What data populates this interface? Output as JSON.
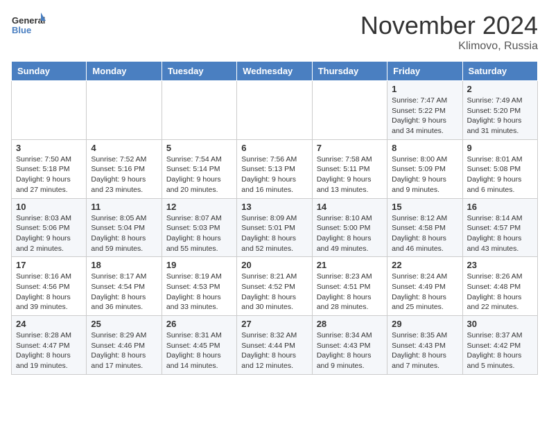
{
  "header": {
    "logo_line1": "General",
    "logo_line2": "Blue",
    "month": "November 2024",
    "location": "Klimovo, Russia"
  },
  "days_of_week": [
    "Sunday",
    "Monday",
    "Tuesday",
    "Wednesday",
    "Thursday",
    "Friday",
    "Saturday"
  ],
  "weeks": [
    [
      {
        "day": "",
        "info": ""
      },
      {
        "day": "",
        "info": ""
      },
      {
        "day": "",
        "info": ""
      },
      {
        "day": "",
        "info": ""
      },
      {
        "day": "",
        "info": ""
      },
      {
        "day": "1",
        "info": "Sunrise: 7:47 AM\nSunset: 5:22 PM\nDaylight: 9 hours and 34 minutes."
      },
      {
        "day": "2",
        "info": "Sunrise: 7:49 AM\nSunset: 5:20 PM\nDaylight: 9 hours and 31 minutes."
      }
    ],
    [
      {
        "day": "3",
        "info": "Sunrise: 7:50 AM\nSunset: 5:18 PM\nDaylight: 9 hours and 27 minutes."
      },
      {
        "day": "4",
        "info": "Sunrise: 7:52 AM\nSunset: 5:16 PM\nDaylight: 9 hours and 23 minutes."
      },
      {
        "day": "5",
        "info": "Sunrise: 7:54 AM\nSunset: 5:14 PM\nDaylight: 9 hours and 20 minutes."
      },
      {
        "day": "6",
        "info": "Sunrise: 7:56 AM\nSunset: 5:13 PM\nDaylight: 9 hours and 16 minutes."
      },
      {
        "day": "7",
        "info": "Sunrise: 7:58 AM\nSunset: 5:11 PM\nDaylight: 9 hours and 13 minutes."
      },
      {
        "day": "8",
        "info": "Sunrise: 8:00 AM\nSunset: 5:09 PM\nDaylight: 9 hours and 9 minutes."
      },
      {
        "day": "9",
        "info": "Sunrise: 8:01 AM\nSunset: 5:08 PM\nDaylight: 9 hours and 6 minutes."
      }
    ],
    [
      {
        "day": "10",
        "info": "Sunrise: 8:03 AM\nSunset: 5:06 PM\nDaylight: 9 hours and 2 minutes."
      },
      {
        "day": "11",
        "info": "Sunrise: 8:05 AM\nSunset: 5:04 PM\nDaylight: 8 hours and 59 minutes."
      },
      {
        "day": "12",
        "info": "Sunrise: 8:07 AM\nSunset: 5:03 PM\nDaylight: 8 hours and 55 minutes."
      },
      {
        "day": "13",
        "info": "Sunrise: 8:09 AM\nSunset: 5:01 PM\nDaylight: 8 hours and 52 minutes."
      },
      {
        "day": "14",
        "info": "Sunrise: 8:10 AM\nSunset: 5:00 PM\nDaylight: 8 hours and 49 minutes."
      },
      {
        "day": "15",
        "info": "Sunrise: 8:12 AM\nSunset: 4:58 PM\nDaylight: 8 hours and 46 minutes."
      },
      {
        "day": "16",
        "info": "Sunrise: 8:14 AM\nSunset: 4:57 PM\nDaylight: 8 hours and 43 minutes."
      }
    ],
    [
      {
        "day": "17",
        "info": "Sunrise: 8:16 AM\nSunset: 4:56 PM\nDaylight: 8 hours and 39 minutes."
      },
      {
        "day": "18",
        "info": "Sunrise: 8:17 AM\nSunset: 4:54 PM\nDaylight: 8 hours and 36 minutes."
      },
      {
        "day": "19",
        "info": "Sunrise: 8:19 AM\nSunset: 4:53 PM\nDaylight: 8 hours and 33 minutes."
      },
      {
        "day": "20",
        "info": "Sunrise: 8:21 AM\nSunset: 4:52 PM\nDaylight: 8 hours and 30 minutes."
      },
      {
        "day": "21",
        "info": "Sunrise: 8:23 AM\nSunset: 4:51 PM\nDaylight: 8 hours and 28 minutes."
      },
      {
        "day": "22",
        "info": "Sunrise: 8:24 AM\nSunset: 4:49 PM\nDaylight: 8 hours and 25 minutes."
      },
      {
        "day": "23",
        "info": "Sunrise: 8:26 AM\nSunset: 4:48 PM\nDaylight: 8 hours and 22 minutes."
      }
    ],
    [
      {
        "day": "24",
        "info": "Sunrise: 8:28 AM\nSunset: 4:47 PM\nDaylight: 8 hours and 19 minutes."
      },
      {
        "day": "25",
        "info": "Sunrise: 8:29 AM\nSunset: 4:46 PM\nDaylight: 8 hours and 17 minutes."
      },
      {
        "day": "26",
        "info": "Sunrise: 8:31 AM\nSunset: 4:45 PM\nDaylight: 8 hours and 14 minutes."
      },
      {
        "day": "27",
        "info": "Sunrise: 8:32 AM\nSunset: 4:44 PM\nDaylight: 8 hours and 12 minutes."
      },
      {
        "day": "28",
        "info": "Sunrise: 8:34 AM\nSunset: 4:43 PM\nDaylight: 8 hours and 9 minutes."
      },
      {
        "day": "29",
        "info": "Sunrise: 8:35 AM\nSunset: 4:43 PM\nDaylight: 8 hours and 7 minutes."
      },
      {
        "day": "30",
        "info": "Sunrise: 8:37 AM\nSunset: 4:42 PM\nDaylight: 8 hours and 5 minutes."
      }
    ]
  ]
}
